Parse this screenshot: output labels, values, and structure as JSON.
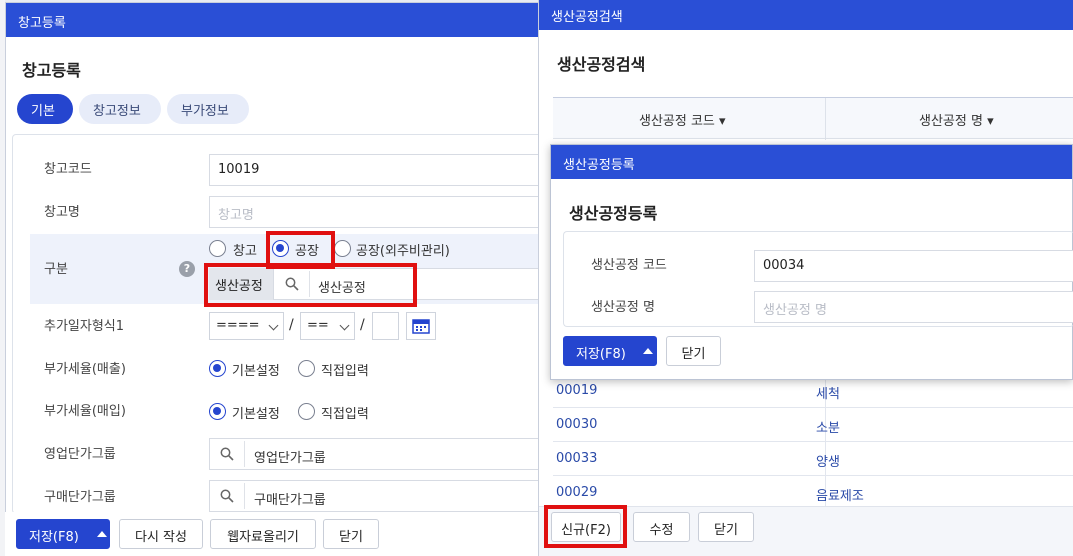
{
  "window_main": {
    "title": "창고등록",
    "heading": "창고등록",
    "tabs": [
      "기본",
      "창고정보",
      "부가정보"
    ],
    "fields": {
      "code_label": "창고코드",
      "code_value": "10019",
      "name_label": "창고명",
      "name_placeholder": "창고명",
      "type_label": "구분",
      "type_options": [
        "창고",
        "공장",
        "공장(외주비관리)"
      ],
      "type_selected": "공장",
      "process_tag": "생산공정",
      "process_placeholder": "생산공정",
      "date_format_label": "추가일자형식1",
      "date_sel1": "====",
      "date_sel2": "==",
      "date_sep": "/",
      "vat_sales_label": "부가세율(매출)",
      "vat_purchase_label": "부가세율(매입)",
      "vat_options": [
        "기본설정",
        "직접입력"
      ],
      "sales_price_label": "영업단가그룹",
      "sales_price_placeholder": "영업단가그룹",
      "purchase_price_label": "구매단가그룹",
      "purchase_price_placeholder": "구매단가그룹"
    },
    "buttons": {
      "save": "저장(F8)",
      "rewrite": "다시 작성",
      "upload": "웹자료올리기",
      "close": "닫기"
    }
  },
  "window_search": {
    "title": "생산공정검색",
    "heading": "생산공정검색",
    "columns": [
      "생산공정 코드",
      "생산공정 명"
    ],
    "rows": [
      {
        "code": "00019",
        "name": "세척"
      },
      {
        "code": "00030",
        "name": "소분"
      },
      {
        "code": "00033",
        "name": "양생"
      },
      {
        "code": "00029",
        "name": "음료제조"
      }
    ],
    "buttons": {
      "new": "신규(F2)",
      "edit": "수정",
      "close": "닫기"
    }
  },
  "window_register": {
    "title": "생산공정등록",
    "heading": "생산공정등록",
    "code_label": "생산공정 코드",
    "code_value": "00034",
    "name_label": "생산공정 명",
    "name_placeholder": "생산공정 명",
    "buttons": {
      "save": "저장(F8)",
      "close": "닫기"
    }
  },
  "colors": {
    "accent": "#2545cf",
    "titlebar": "#2a4fd6",
    "highlight": "#e01010"
  }
}
